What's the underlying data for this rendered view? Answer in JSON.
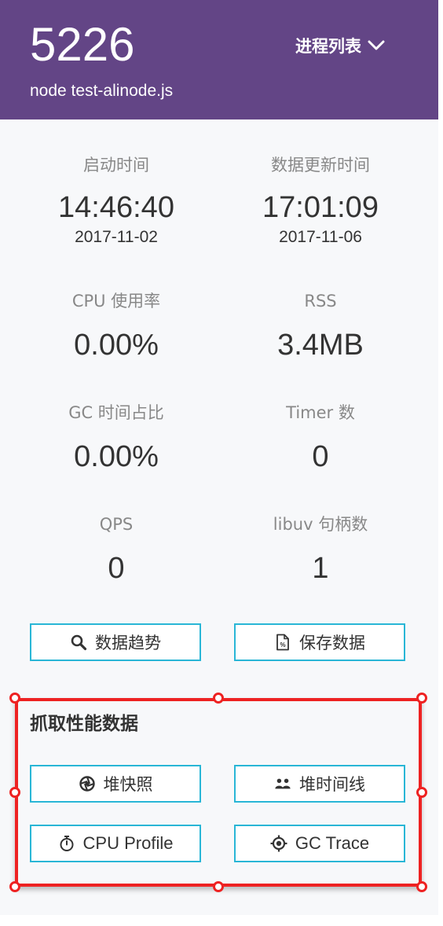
{
  "header": {
    "pid": "5226",
    "command": "node test-alinode.js",
    "process_list_label": "进程列表"
  },
  "stats": {
    "start_time": {
      "label": "启动时间",
      "time": "14:46:40",
      "date": "2017-11-02"
    },
    "update_time": {
      "label": "数据更新时间",
      "time": "17:01:09",
      "date": "2017-11-06"
    },
    "cpu_usage": {
      "label": "CPU 使用率",
      "value": "0.00%"
    },
    "rss": {
      "label": "RSS",
      "value": "3.4MB"
    },
    "gc_ratio": {
      "label": "GC 时间占比",
      "value": "0.00%"
    },
    "timer_count": {
      "label": "Timer 数",
      "value": "0"
    },
    "qps": {
      "label": "QPS",
      "value": "0"
    },
    "libuv_handles": {
      "label": "libuv 句柄数",
      "value": "1"
    }
  },
  "actions": {
    "data_trend": {
      "label": "数据趋势",
      "icon": "search-icon"
    },
    "save_data": {
      "label": "保存数据",
      "icon": "file-percent-icon"
    }
  },
  "capture": {
    "title": "抓取性能数据",
    "heap_snapshot": {
      "label": "堆快照",
      "icon": "aperture-icon"
    },
    "heap_timeline": {
      "label": "堆时间线",
      "icon": "users-icon"
    },
    "cpu_profile": {
      "label": "CPU Profile",
      "icon": "stopwatch-icon"
    },
    "gc_trace": {
      "label": "GC Trace",
      "icon": "crosshair-icon"
    }
  },
  "colors": {
    "header_bg": "#634586",
    "button_border": "#29b6d6",
    "selection": "#ee2222",
    "panel_bg": "#f7f8fa"
  }
}
